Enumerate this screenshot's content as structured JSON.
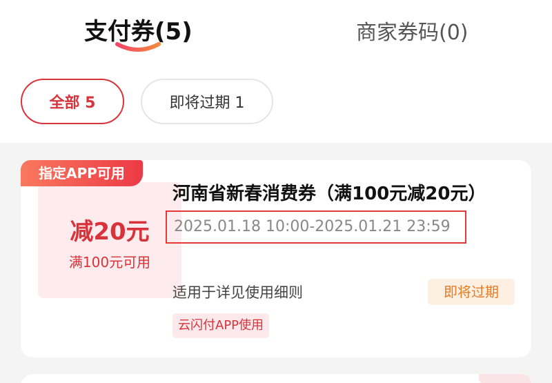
{
  "tabs": {
    "payment": "支付券(5)",
    "merchant": "商家券码(0)"
  },
  "filters": {
    "all": "全部 5",
    "expiring": "即将过期 1"
  },
  "coupon": {
    "app_tag": "指定APP可用",
    "amount": "减20元",
    "condition": "满100元可用",
    "title": "河南省新春消费券（满100元减20元）",
    "validity": "2025.01.18 10:00-2025.01.21 23:59",
    "scope": "适用于详见使用细则",
    "expiring_badge": "即将过期",
    "channel": "云闪付APP使用"
  },
  "colors": {
    "accent": "#d8323a",
    "warning": "#e47b25"
  }
}
